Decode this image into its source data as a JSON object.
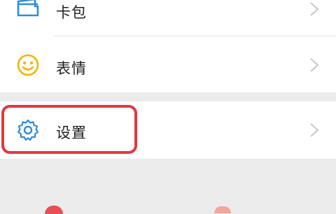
{
  "menu": {
    "items": [
      {
        "label": "卡包",
        "icon": "card-wallet-icon"
      },
      {
        "label": "表情",
        "icon": "smiley-face-icon"
      },
      {
        "label": "设置",
        "icon": "gear-icon"
      }
    ]
  },
  "colors": {
    "highlight": "#e03a3f",
    "wallet_icon": "#2f8dd6",
    "emoji_icon": "#f4b400",
    "settings_icon": "#2f8dd6",
    "chevron": "#c7c7c7",
    "background": "#ececec"
  }
}
